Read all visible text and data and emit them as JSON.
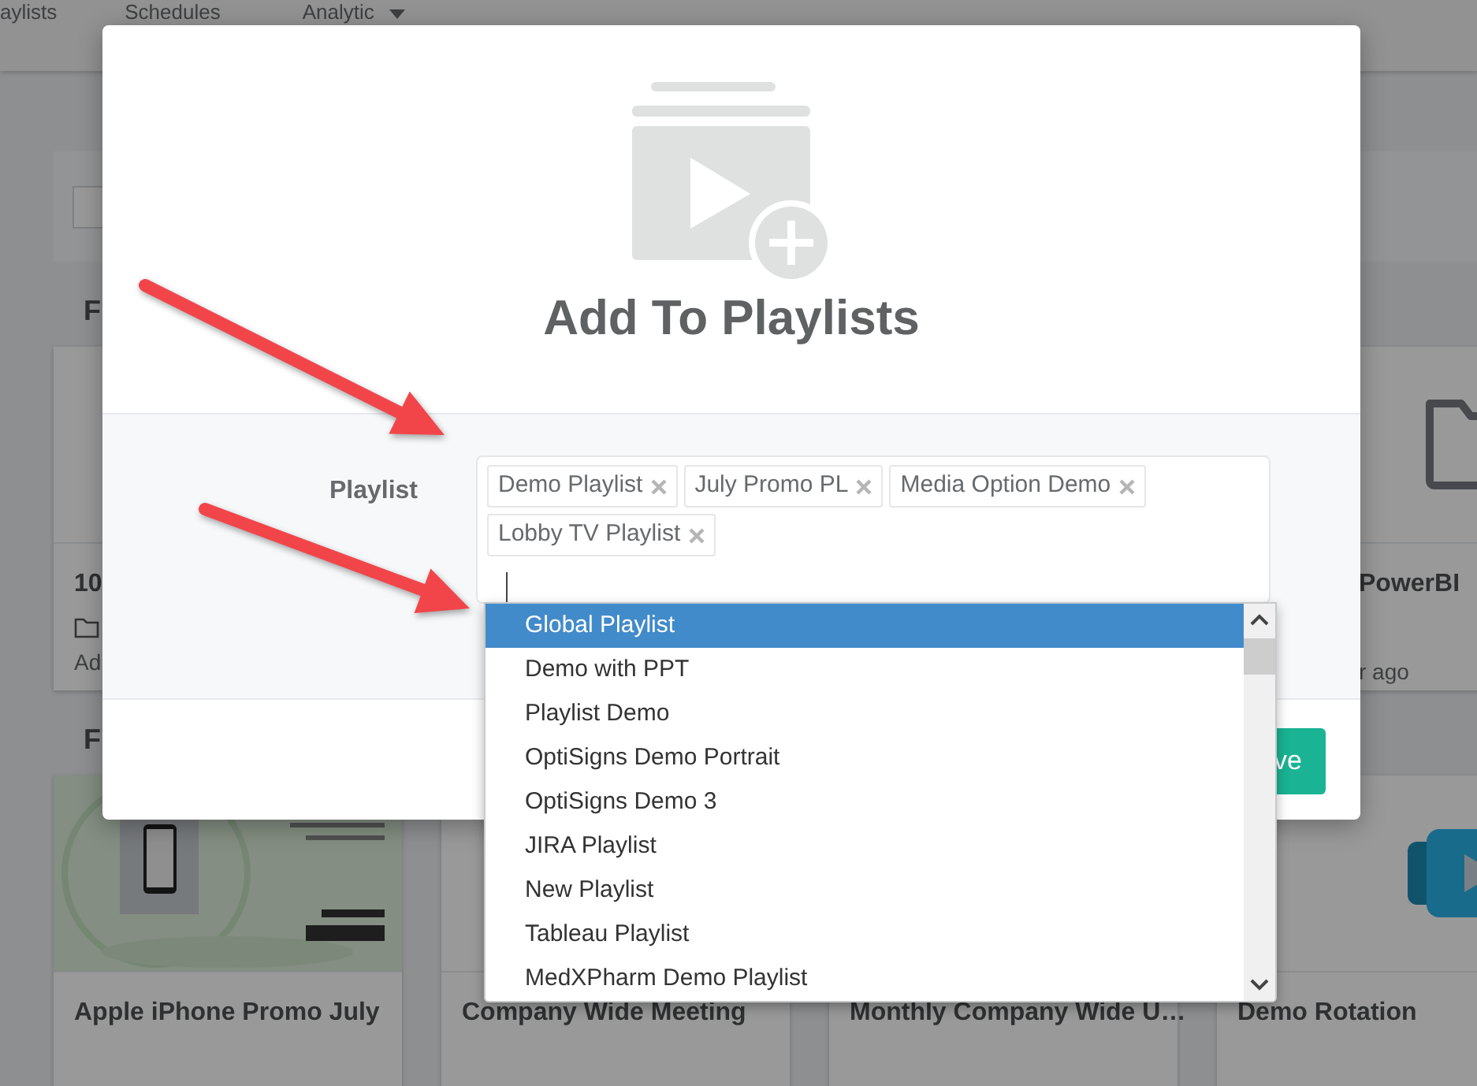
{
  "nav": {
    "items": [
      {
        "label": "aylists",
        "kind": "link"
      },
      {
        "label": "Schedules",
        "kind": "link"
      },
      {
        "label": "Analytic",
        "kind": "dropdown"
      }
    ]
  },
  "sections": [
    {
      "heading": "F",
      "cards": [
        {
          "title": "10",
          "meta": "Ad"
        },
        {
          "title": "PowerBI",
          "meta": "r ago",
          "kind": "folder"
        }
      ]
    },
    {
      "heading": "F",
      "cards": [
        {
          "title": "Apple iPhone Promo July",
          "kind": "picture"
        },
        {
          "title": "Company Wide Meeting"
        },
        {
          "title": "Monthly Company Wide U…"
        },
        {
          "title": "Demo Rotation",
          "kind": "playlist"
        }
      ]
    }
  ],
  "modal": {
    "title": "Add To Playlists",
    "field_label": "Playlist",
    "tags": [
      "Demo Playlist",
      "July Promo PL",
      "Media Option Demo",
      "Lobby TV Playlist"
    ],
    "options": [
      {
        "label": "Global Playlist",
        "selected": true
      },
      {
        "label": "Demo with PPT",
        "selected": false
      },
      {
        "label": "Playlist Demo",
        "selected": false
      },
      {
        "label": "OptiSigns Demo Portrait",
        "selected": false
      },
      {
        "label": "OptiSigns Demo 3",
        "selected": false
      },
      {
        "label": "JIRA Playlist",
        "selected": false
      },
      {
        "label": "New Playlist",
        "selected": false
      },
      {
        "label": "Tableau Playlist",
        "selected": false
      },
      {
        "label": "MedXPharm Demo Playlist",
        "selected": false
      }
    ],
    "save_button": "ve"
  }
}
